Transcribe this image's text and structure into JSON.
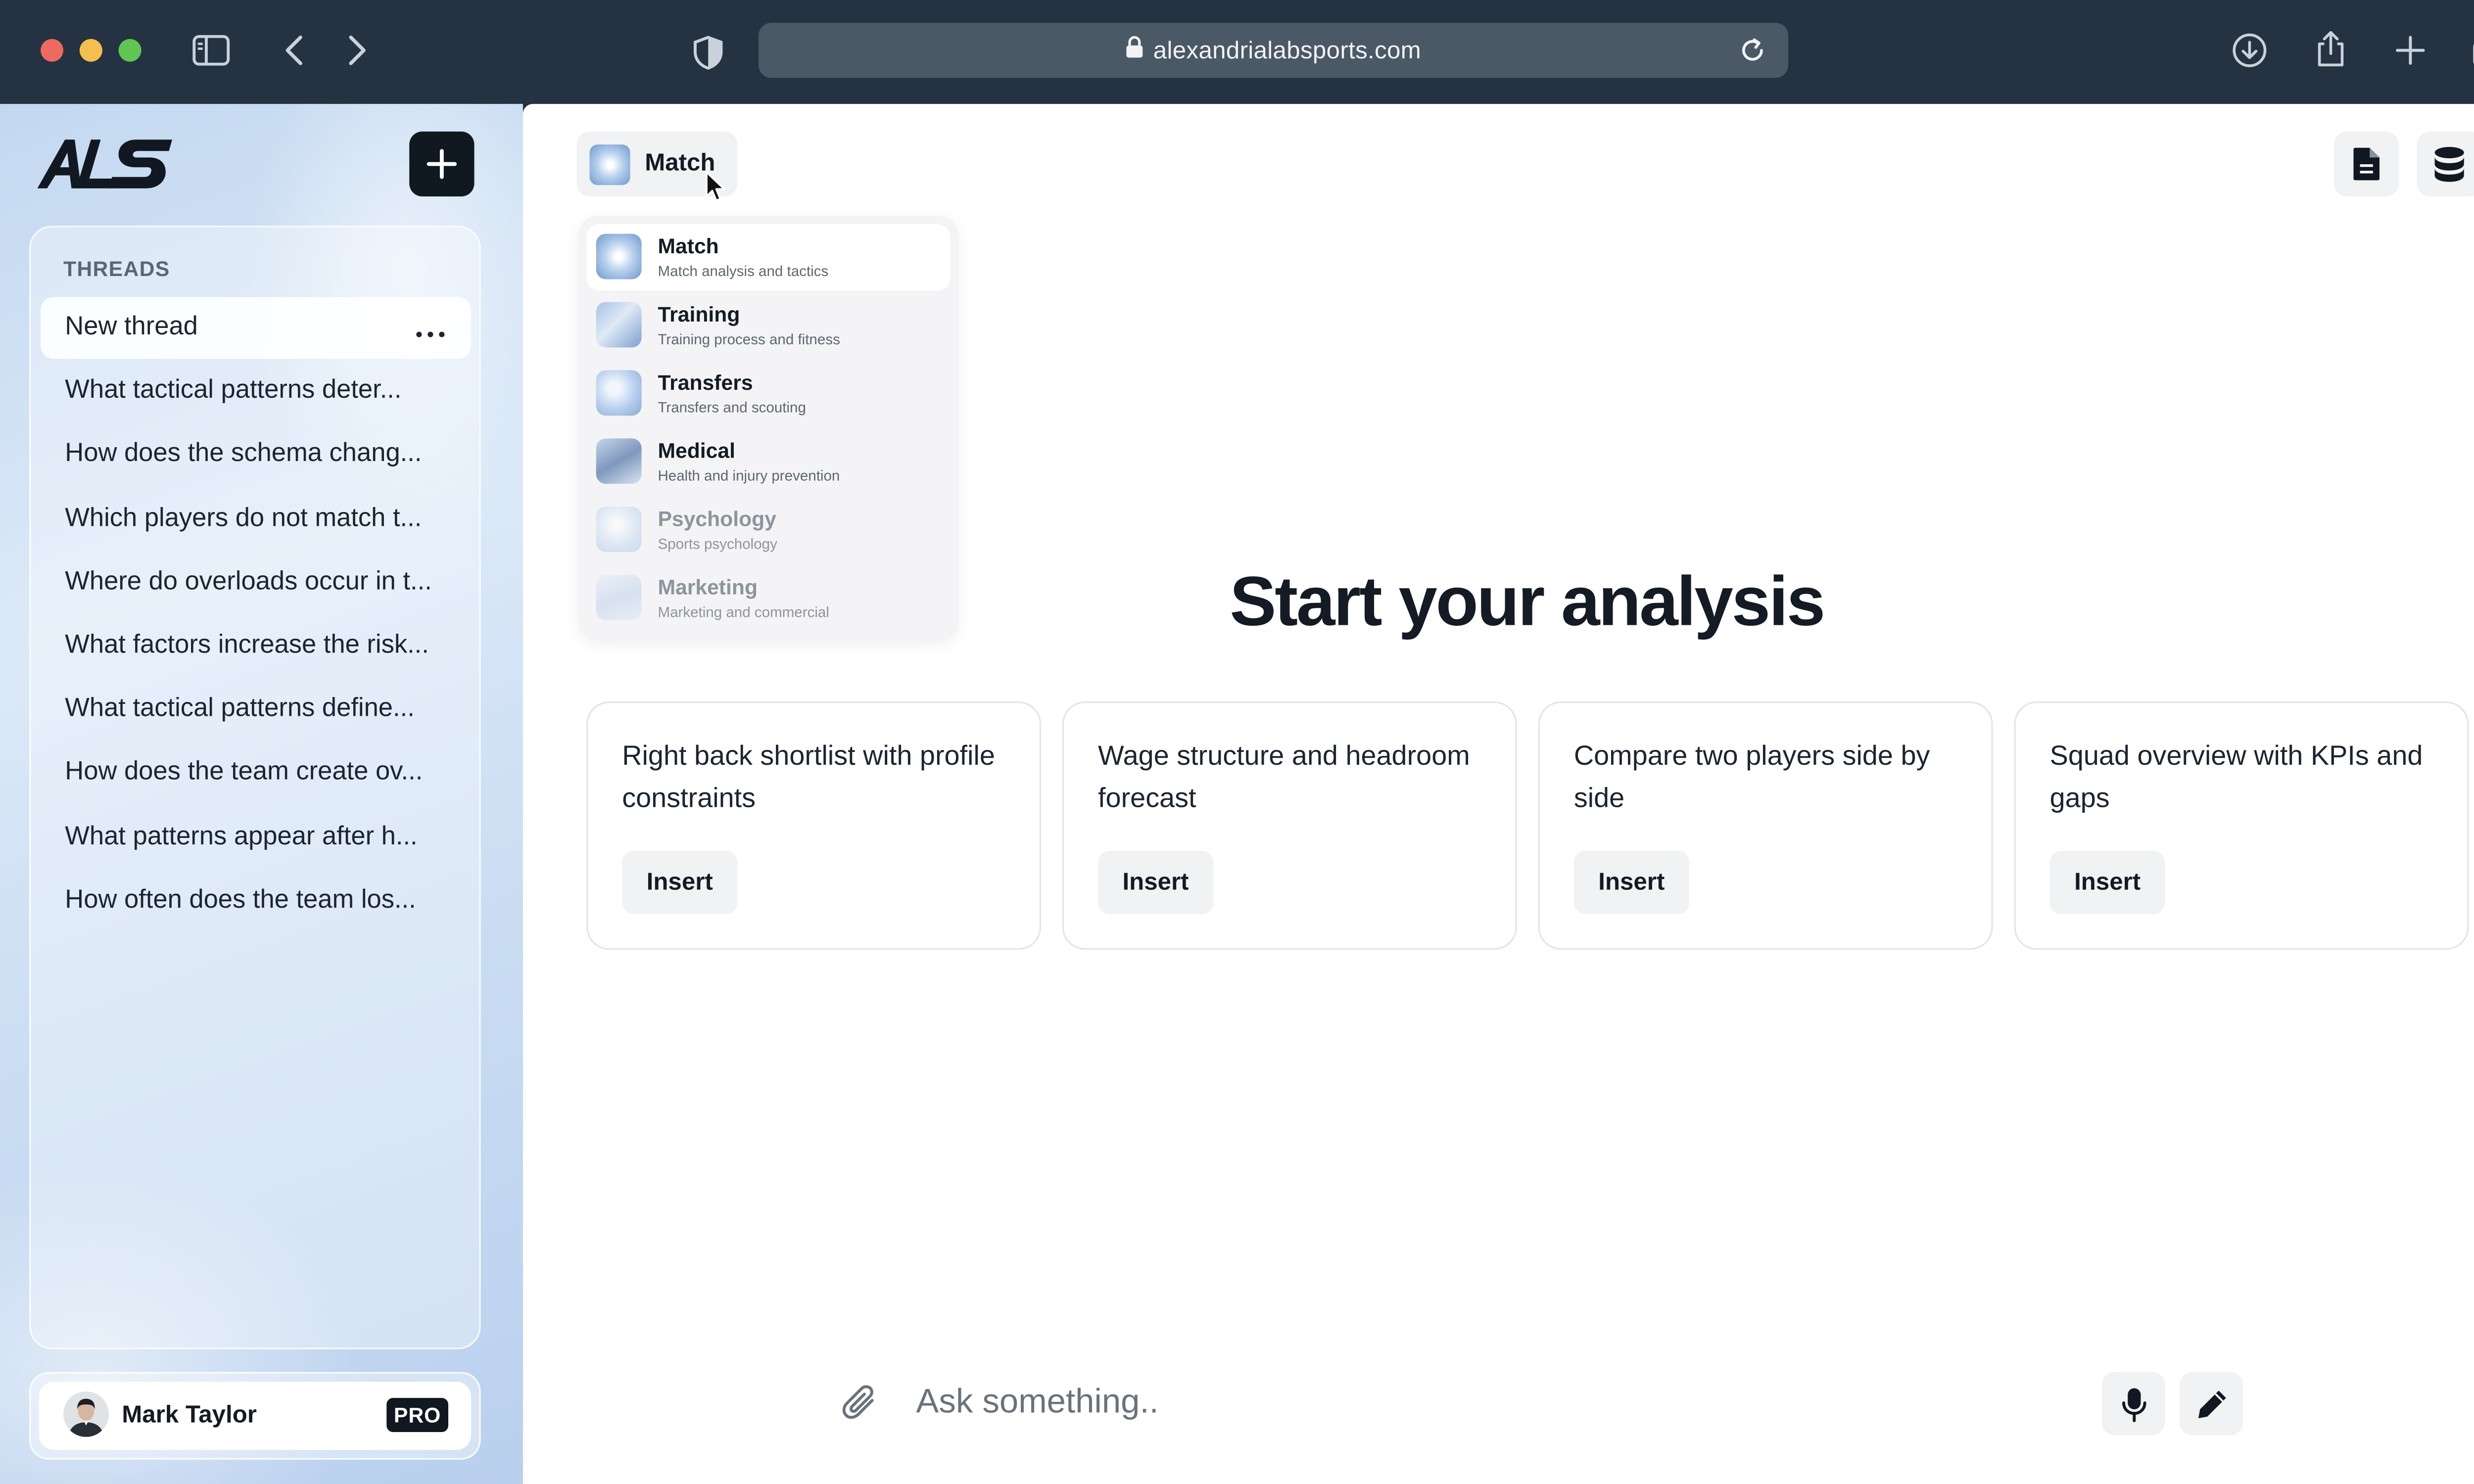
{
  "browser": {
    "url": "alexandrialabsports.com",
    "traffic_colors": [
      "#ec6a5e",
      "#f4bf4f",
      "#61c554"
    ],
    "icons": [
      "sidebar-toggle-icon",
      "back-arrow-icon",
      "forward-arrow-icon",
      "shield-icon",
      "lock-icon",
      "reload-icon",
      "download-icon",
      "share-icon",
      "new-tab-icon",
      "tab-overview-icon"
    ]
  },
  "sidebar": {
    "logo_text": "ALS",
    "threads_title": "THREADS",
    "threads": [
      "New thread",
      "What tactical patterns deter...",
      "How does the schema chang...",
      "Which players do not match t...",
      "Where do overloads occur in t...",
      "What factors increase the risk...",
      "What tactical patterns define...",
      "How does the team create ov...",
      "What patterns appear after h...",
      "How often does the team los..."
    ],
    "active_thread": 0,
    "user": {
      "name": "Mark Taylor",
      "badge": "PRO"
    }
  },
  "main": {
    "mode_button_label": "Match",
    "dropdown": [
      {
        "title": "Match",
        "subtitle": "Match analysis and tactics"
      },
      {
        "title": "Training",
        "subtitle": "Training process and fitness"
      },
      {
        "title": "Transfers",
        "subtitle": "Transfers and scouting"
      },
      {
        "title": "Medical",
        "subtitle": "Health and injury prevention"
      },
      {
        "title": "Psychology",
        "subtitle": "Sports psychology"
      },
      {
        "title": "Marketing",
        "subtitle": "Marketing and commercial"
      }
    ],
    "headline": "Start your analysis",
    "cards": [
      {
        "text": "Right back shortlist with profile constraints",
        "button": "Insert"
      },
      {
        "text": "Wage structure and headroom forecast",
        "button": "Insert"
      },
      {
        "text": "Compare two players side by side",
        "button": "Insert"
      },
      {
        "text": "Squad overview with KPIs and gaps",
        "button": "Insert"
      }
    ],
    "composer": {
      "placeholder": "Ask something..",
      "value": ""
    }
  }
}
